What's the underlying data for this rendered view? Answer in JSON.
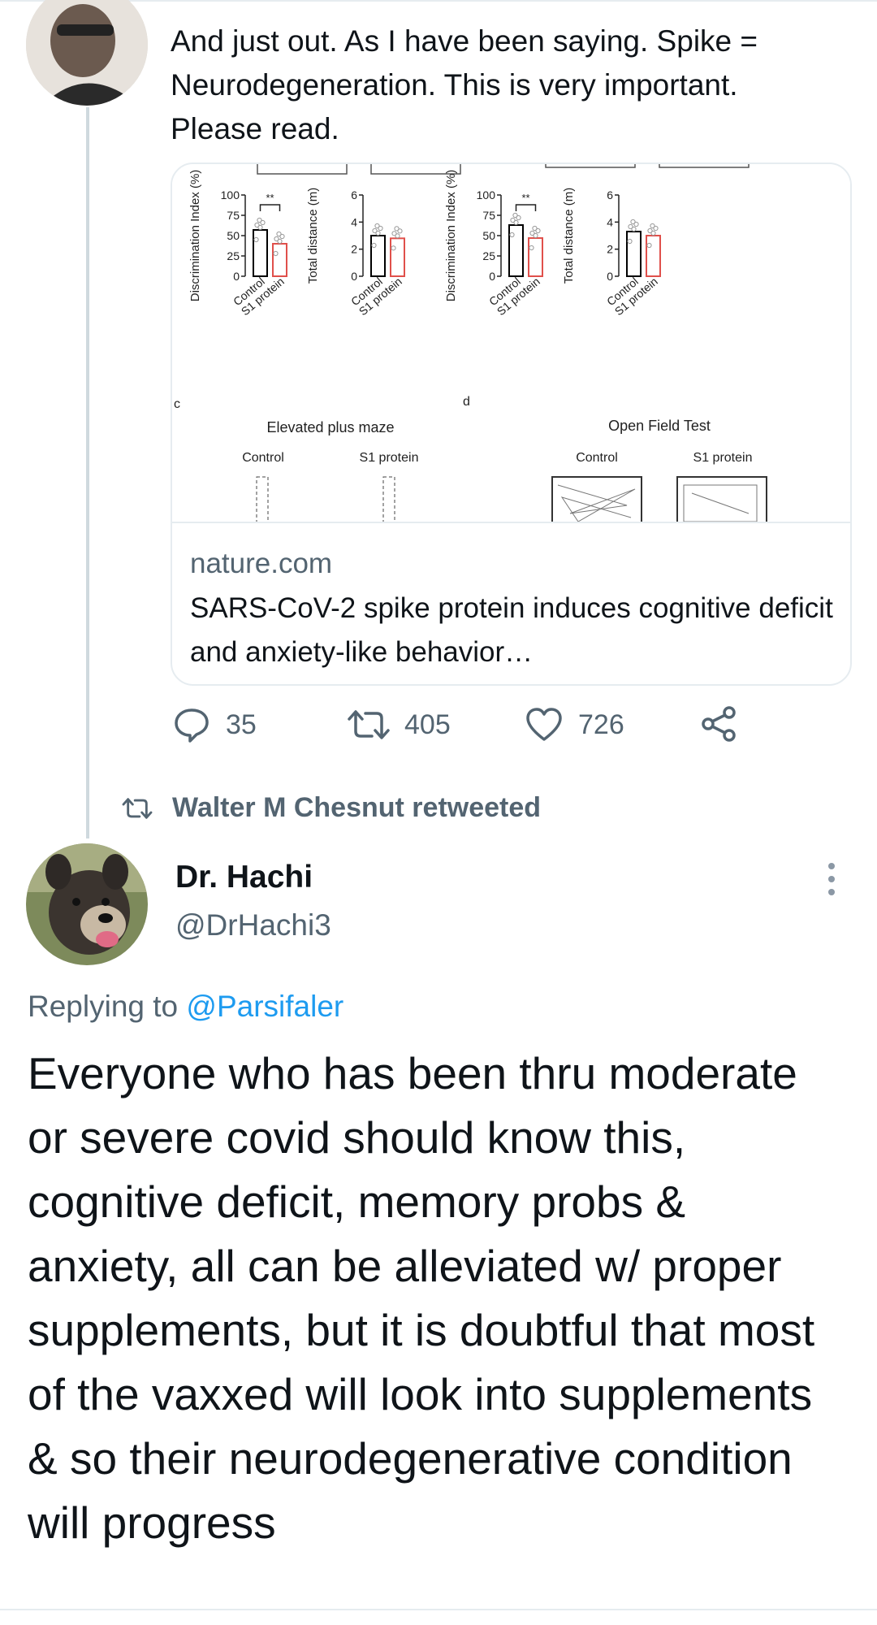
{
  "first_tweet": {
    "text": "And just out. As I have been saying. Spike = Neurodegeneration. This is very important. Please read.",
    "card": {
      "domain": "nature.com",
      "title": "SARS-CoV-2 spike protein induces cognitive deficit and anxiety-like behavior…",
      "figure": {
        "panel_c": "c",
        "panel_d": "d",
        "epm_title": "Elevated plus maze",
        "oft_title": "Open Field Test",
        "control_label": "Control",
        "s1_label": "S1 protein",
        "di_ylabel": "Discrimination Index (%)",
        "td_ylabel": "Total distance (m)",
        "di_ticks": [
          "0",
          "25",
          "50",
          "75",
          "100"
        ],
        "td_ticks": [
          "0",
          "2",
          "4",
          "6"
        ],
        "sig": "**",
        "colors": {
          "control": "#000000",
          "s1": "#e0504b"
        }
      }
    },
    "actions": {
      "reply_count": "35",
      "retweet_count": "405",
      "like_count": "726"
    }
  },
  "retweet_banner": "Walter M Chesnut retweeted",
  "second_tweet": {
    "name": "Dr. Hachi",
    "handle": "@DrHachi3",
    "replying_prefix": "Replying to",
    "replying_handle": "@Parsifaler",
    "text": "Everyone who has been thru moderate or severe covid should know this, cognitive deficit, memory probs & anxiety, all can be alleviated w/ proper supplements, but it is doubtful that most of the vaxxed will look into supplements & so their neurodegenerative condition will progress"
  },
  "chart_data": [
    {
      "type": "bar",
      "categories": [
        "Control",
        "S1 protein"
      ],
      "values": [
        57,
        40
      ],
      "ylabel": "Discrimination Index (%)",
      "ylim": [
        0,
        100
      ]
    },
    {
      "type": "bar",
      "categories": [
        "Control",
        "S1 protein"
      ],
      "values": [
        3.0,
        2.8
      ],
      "ylabel": "Total distance (m)",
      "ylim": [
        0,
        6
      ]
    },
    {
      "type": "bar",
      "categories": [
        "Control",
        "S1 protein"
      ],
      "values": [
        63,
        47
      ],
      "ylabel": "Discrimination Index (%)",
      "ylim": [
        0,
        100
      ]
    },
    {
      "type": "bar",
      "categories": [
        "Control",
        "S1 protein"
      ],
      "values": [
        3.3,
        3.0
      ],
      "ylabel": "Total distance (m)",
      "ylim": [
        0,
        6
      ]
    }
  ]
}
